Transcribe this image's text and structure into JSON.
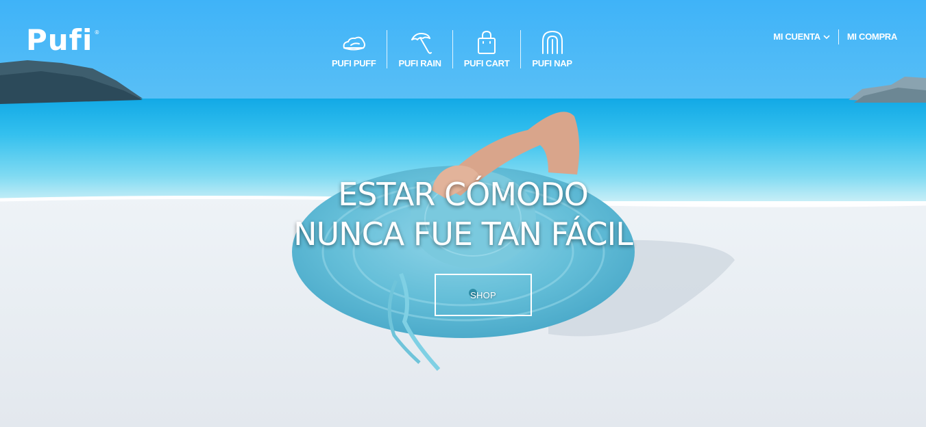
{
  "brand": {
    "name": "Pufi",
    "mark": "®"
  },
  "nav": [
    {
      "label": "PUFI PUFF",
      "icon": "pouf-icon"
    },
    {
      "label": "PUFI RAIN",
      "icon": "umbrella-icon"
    },
    {
      "label": "PUFI CART",
      "icon": "shopping-bag-icon"
    },
    {
      "label": "PUFI NAP",
      "icon": "sleeping-bag-icon"
    }
  ],
  "account": {
    "my_account": "MI CUENTA",
    "my_purchase": "MI COMPRA"
  },
  "hero": {
    "line1": "ESTAR CÓMODO",
    "line2": "NUNCA FUE TAN FÁCIL",
    "button": "SHOP"
  },
  "colors": {
    "sky": "#4AB6F7",
    "sea": "#5FD3F2",
    "sand": "#F2F4F7",
    "hat": "#6EC3DA"
  }
}
